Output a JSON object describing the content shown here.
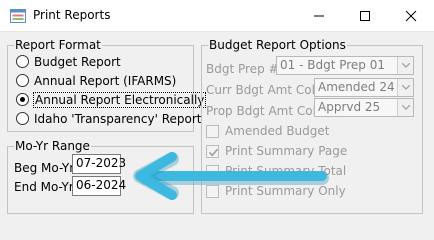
{
  "window": {
    "title": "Print Reports",
    "icon": "report-app-icon",
    "controls": [
      "minimize-icon",
      "maximize-icon",
      "close-icon"
    ]
  },
  "report_format": {
    "legend": "Report Format",
    "options": [
      {
        "label": "Budget Report",
        "selected": false
      },
      {
        "label": "Annual Report (IFARMS)",
        "selected": false
      },
      {
        "label": "Annual Report Electronically",
        "selected": true
      },
      {
        "label": "Idaho 'Transparency' Report",
        "selected": false
      }
    ]
  },
  "mo_yr_range": {
    "legend": "Mo-Yr Range",
    "beg_label": "Beg Mo-Yr:",
    "beg_value": "07-2023",
    "end_label": "End Mo-Yr:",
    "end_value": "06-2024"
  },
  "budget_options": {
    "legend": "Budget Report Options",
    "bdgt_prep_label": "Bdgt Prep #:",
    "bdgt_prep_value": "01 - Bdgt Prep 01",
    "curr_amt_label": "Curr Bdgt Amt Col:",
    "curr_amt_value": "Amended 24",
    "prop_amt_label": "Prop Bdgt Amt Col:",
    "prop_amt_value": "Apprvd 25",
    "checkboxes": [
      {
        "label": "Amended Budget",
        "checked": false
      },
      {
        "label": "Print Summary Page",
        "checked": true
      },
      {
        "label": "Print Summary Total",
        "checked": false
      },
      {
        "label": "Print Summary Only",
        "checked": false
      }
    ]
  },
  "annotation": {
    "arrow_color": "#3db8e0",
    "arrow_direction": "left"
  }
}
